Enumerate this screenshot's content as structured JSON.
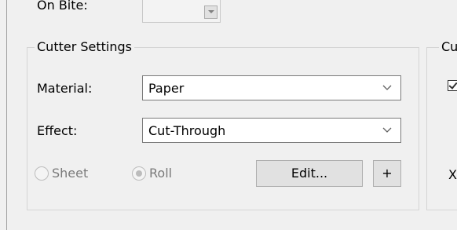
{
  "top_row": {
    "on_bite_label": "On Bite:"
  },
  "cutter_settings": {
    "title": "Cutter Settings",
    "material": {
      "label": "Material:",
      "value": "Paper"
    },
    "effect": {
      "label": "Effect:",
      "value": "Cut-Through"
    },
    "media_type": {
      "sheet_label": "Sheet",
      "roll_label": "Roll",
      "selected": "Roll",
      "enabled": false
    },
    "edit_button": "Edit...",
    "add_button": "+"
  },
  "right_group": {
    "title_partial": "Cu",
    "row_partial_text": "X"
  },
  "colors": {
    "background": "#f0f0f0",
    "border": "#d5d5d5",
    "disabled_text": "#7a7a7a"
  },
  "icons": {
    "combo_chevron": "chevron-down-icon",
    "spin_down": "triangle-down-icon",
    "checkbox": "checkmark-icon"
  }
}
